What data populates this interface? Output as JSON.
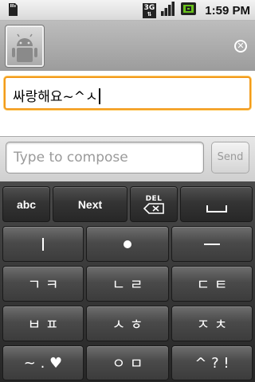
{
  "status_bar": {
    "network": "3G",
    "time": "1:59 PM",
    "icons": [
      "sd-card-icon",
      "network-3g-icon",
      "signal-icon",
      "battery-icon"
    ]
  },
  "header": {
    "avatar": "android-contact-avatar",
    "close_icon": "close-icon"
  },
  "recipient": {
    "value": "싸랑해요~^ㅅ"
  },
  "compose": {
    "placeholder": "Type to compose",
    "send_label": "Send"
  },
  "keyboard": {
    "row1": {
      "abc": "abc",
      "next": "Next",
      "del": "DEL",
      "space": "space"
    },
    "row2": [
      "ㅣ",
      "•",
      "ㅡ"
    ],
    "row3": [
      "ㄱ ㅋ",
      "ㄴ ㄹ",
      "ㄷ ㅌ"
    ],
    "row4": [
      "ㅂ ㅍ",
      "ㅅ ㅎ",
      "ㅈ ㅊ"
    ],
    "row5": [
      "~ . ♥",
      "ㅇ ㅁ",
      "^ ? !"
    ]
  },
  "colors": {
    "focus_border": "#f29a1c",
    "battery_green": "#6ac21c",
    "keyboard_bg": "#2e2e2e"
  }
}
